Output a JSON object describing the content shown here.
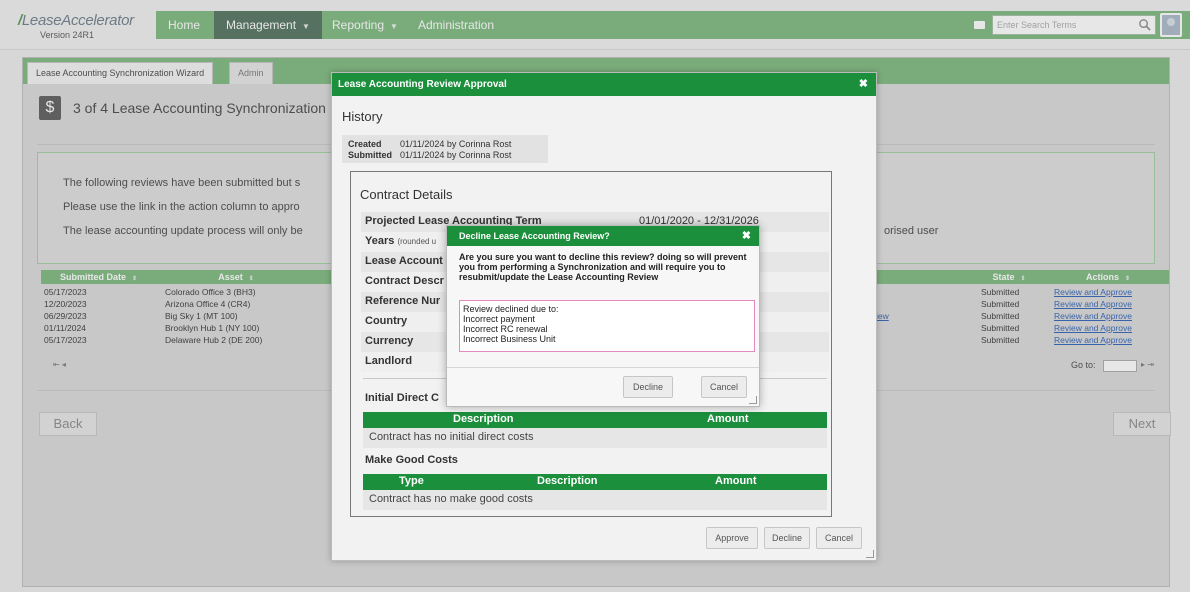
{
  "app": {
    "logo": "LeaseAccelerator",
    "version": "Version 24R1"
  },
  "nav": {
    "items": [
      {
        "label": "Home"
      },
      {
        "label": "Management"
      },
      {
        "label": "Reporting"
      },
      {
        "label": "Administration"
      }
    ],
    "search_placeholder": "Enter Search Terms"
  },
  "tabs": [
    {
      "label": "Lease Accounting Synchronization Wizard"
    },
    {
      "label": "Admin"
    }
  ],
  "wizard": {
    "step_title": "3 of 4 Lease Accounting Synchronization",
    "info": [
      "The following reviews have been submitted but s",
      "Please use the link in the action column to appro",
      "The lease accounting update process will only be"
    ],
    "info_suffix": "orised user"
  },
  "grid": {
    "columns": [
      "Submitted Date",
      "Asset",
      "State",
      "Actions"
    ],
    "rows": [
      {
        "date": "05/17/2023",
        "asset": "Colorado Office 3 (BH3)",
        "state": "Submitted",
        "action": "Review and Approve"
      },
      {
        "date": "12/20/2023",
        "asset": "Arizona Office 4 (CR4)",
        "state": "Submitted",
        "action": "Review and Approve"
      },
      {
        "date": "06/29/2023",
        "asset": "Big Sky 1 (MT 100)",
        "state": "Submitted",
        "action": "Review and Approve"
      },
      {
        "date": "01/11/2024",
        "asset": "Brooklyn Hub 1 (NY 100)",
        "state": "Submitted",
        "action": "Review and Approve"
      },
      {
        "date": "05/17/2023",
        "asset": "Delaware Hub 2 (DE 200)",
        "state": "Submitted",
        "action": "Review and Approve"
      }
    ],
    "partial_link": "iew",
    "goto_label": "Go to:"
  },
  "wizard_nav": {
    "back": "Back",
    "next": "Next"
  },
  "review_modal": {
    "title": "Lease Accounting Review Approval",
    "history_title": "History",
    "history": [
      {
        "label": "Created",
        "value": "01/11/2024 by Corinna Rost"
      },
      {
        "label": "Submitted",
        "value": "01/11/2024 by Corinna Rost"
      }
    ],
    "contract_title": "Contract Details",
    "contract_rows": [
      {
        "label": "Projected Lease Accounting Term",
        "value": "01/01/2020 - 12/31/2026"
      },
      {
        "label": "Years",
        "note": "(rounded u",
        "value": ""
      },
      {
        "label": "Lease Account",
        "value": ""
      },
      {
        "label": "Contract Descr",
        "value": ""
      },
      {
        "label": "Reference Nur",
        "value": ""
      },
      {
        "label": "Country",
        "value": ""
      },
      {
        "label": "Currency",
        "value": ""
      },
      {
        "label": "Landlord",
        "value": ""
      }
    ],
    "idc_title": "Initial Direct C",
    "idc_columns": [
      "Description",
      "Amount"
    ],
    "idc_empty": "Contract has no initial direct costs",
    "mgc_title": "Make Good Costs",
    "mgc_columns": [
      "Type",
      "Description",
      "Amount"
    ],
    "mgc_empty": "Contract has no make good costs",
    "buttons": {
      "approve": "Approve",
      "decline": "Decline",
      "cancel": "Cancel"
    }
  },
  "decline_dialog": {
    "title": "Decline Lease Accounting Review?",
    "message": "Are you sure you want to decline this review? doing so will prevent you from performing a Synchronization and will require you to resubmit/update the Lease Accounting Review",
    "comment": "Review declined due to:\nIncorrect payment\nIncorrect RC renewal\nIncorrect Business Unit",
    "buttons": {
      "decline": "Decline",
      "cancel": "Cancel"
    }
  },
  "colors": {
    "brand_green": "#1b8f3c",
    "nav_green": "#7ab87c",
    "link_blue": "#2a5fb5"
  }
}
